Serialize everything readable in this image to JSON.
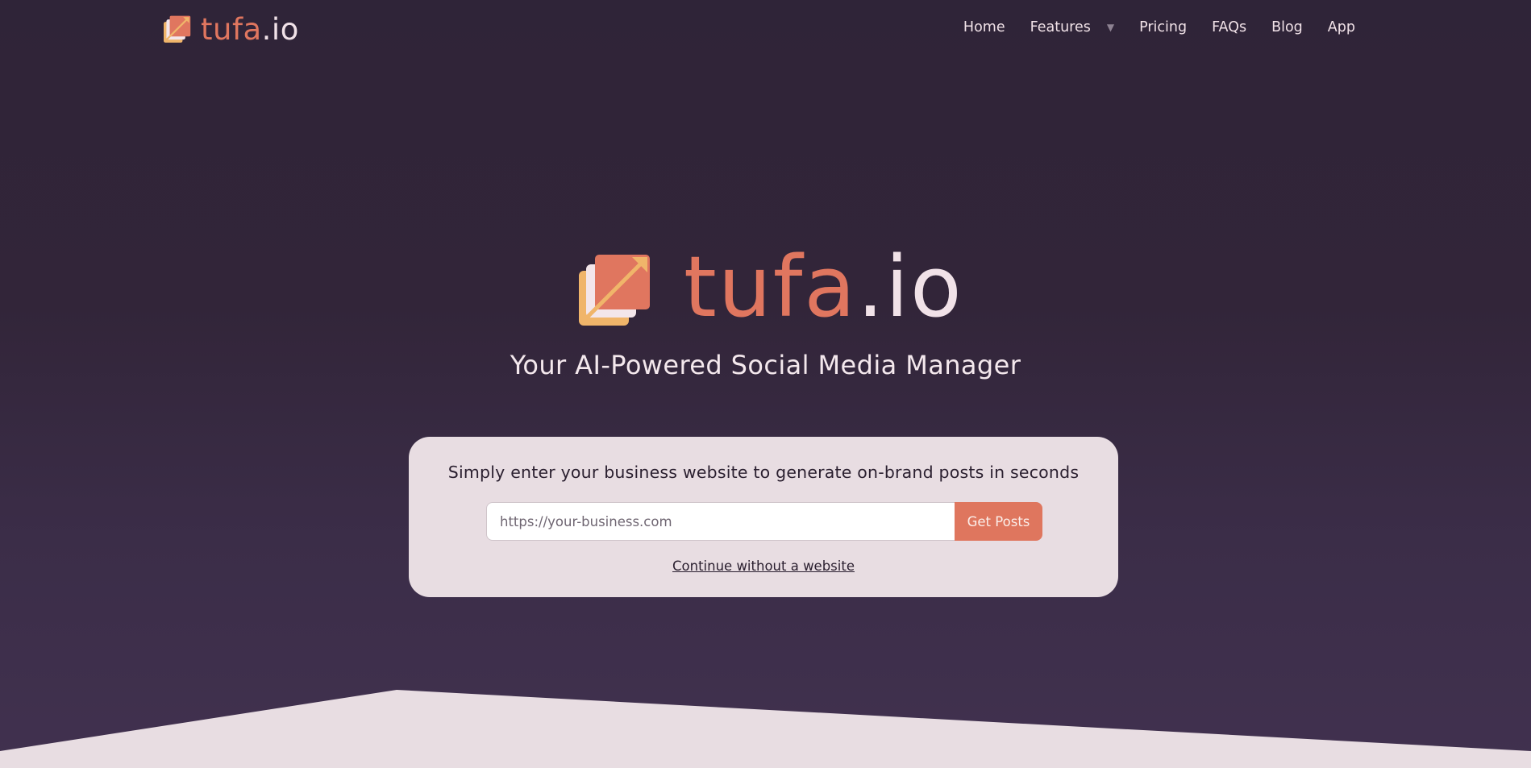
{
  "brand": {
    "name_accent": "tufa",
    "name_light": ".io",
    "logo_icon": "stacked-squares-arrow-icon"
  },
  "nav": {
    "links": [
      {
        "label": "Home"
      },
      {
        "label": "Features",
        "has_dropdown": true,
        "dropdown_icon": "caret-down-icon"
      },
      {
        "label": "Pricing"
      },
      {
        "label": "FAQs"
      },
      {
        "label": "Blog"
      },
      {
        "label": "App"
      }
    ]
  },
  "hero": {
    "tagline": "Your AI-Powered Social Media Manager"
  },
  "signup_card": {
    "prompt": "Simply enter your business website to generate on-brand posts in seconds",
    "url_input": {
      "value": "",
      "placeholder": "https://your-business.com"
    },
    "submit_label": "Get Posts",
    "alt_link": "Continue without a website"
  },
  "colors": {
    "background_top": "#2f2438",
    "background_bottom": "#41314f",
    "accent": "#e0765f",
    "accent_light": "#f0b56a",
    "card_bg": "#e8dde2",
    "text_light": "#f1e2e8",
    "text_dark": "#2a1f2f"
  }
}
